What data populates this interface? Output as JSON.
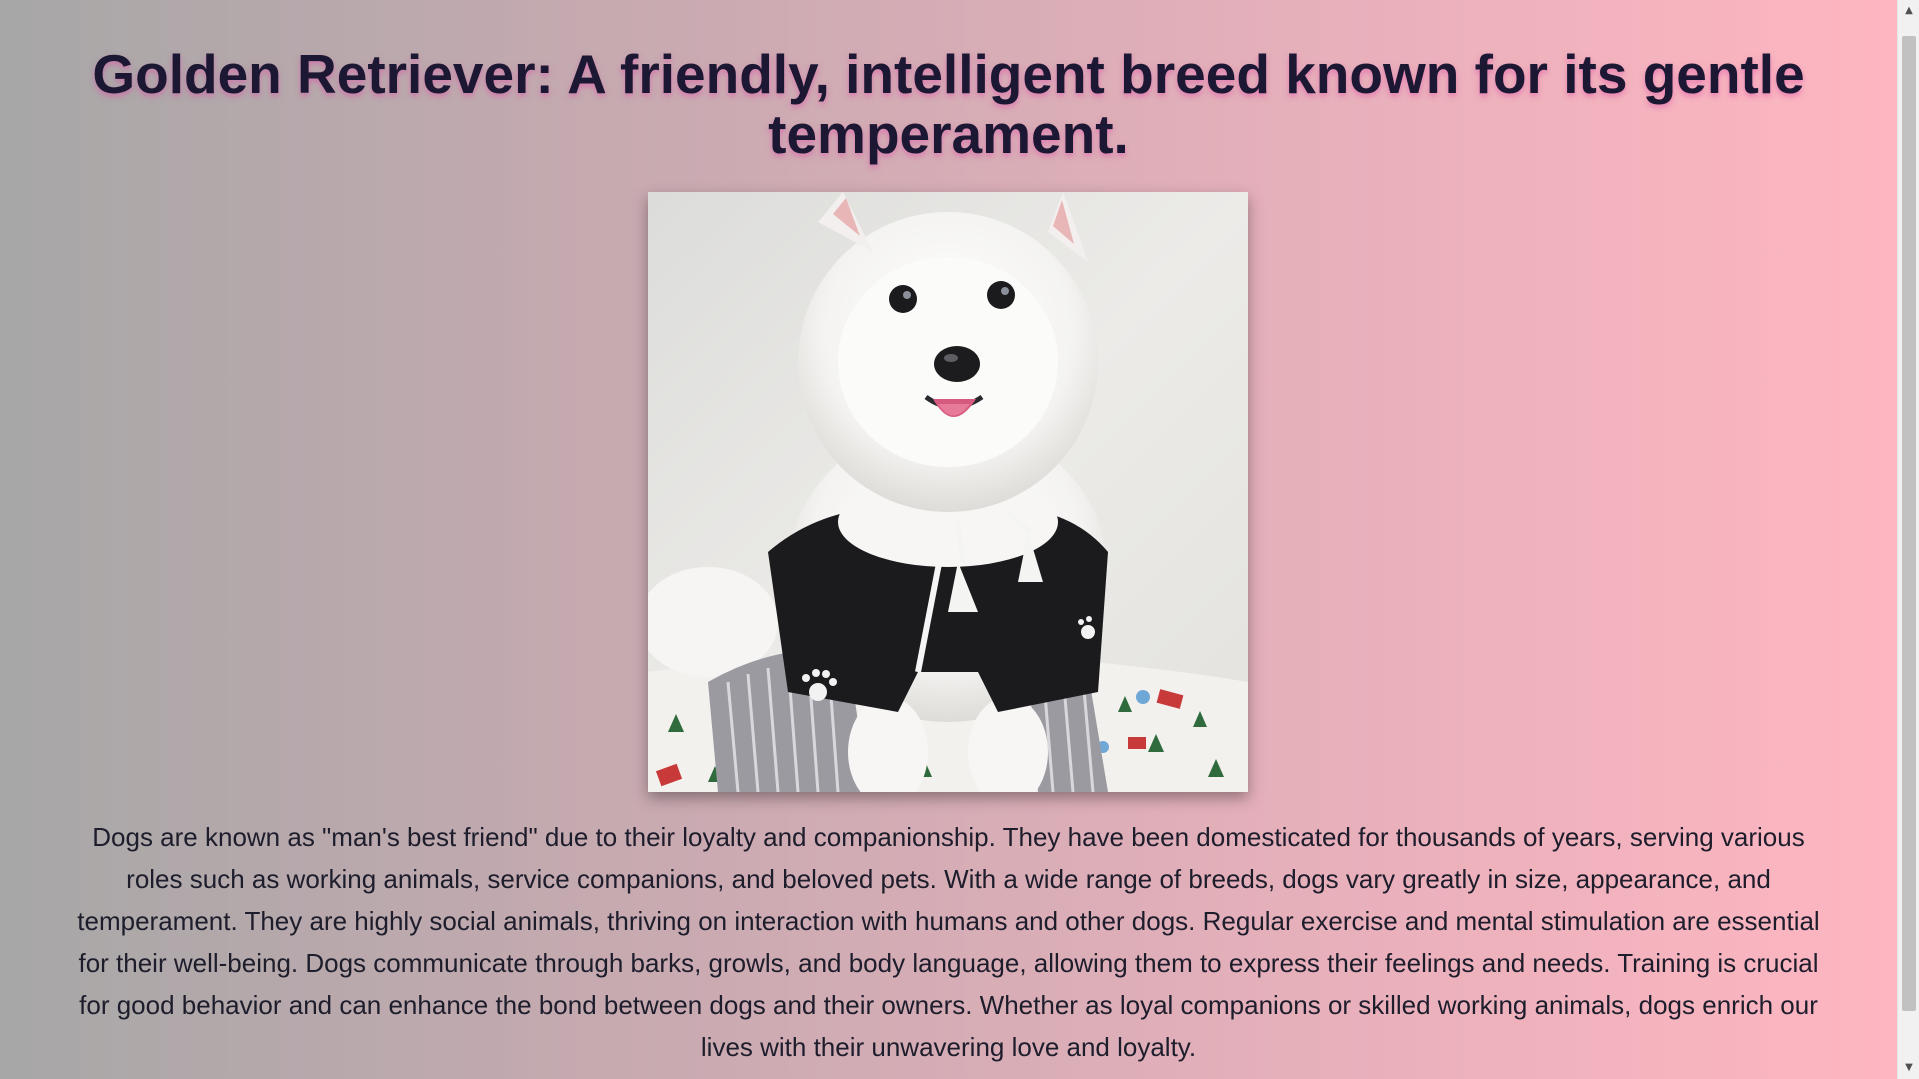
{
  "page": {
    "title": "Golden Retriever: A friendly, intelligent breed known for its gentle temperament.",
    "description": "Dogs are known as \"man's best friend\" due to their loyalty and companionship. They have been domesticated for thousands of years, serving various roles such as working animals, service companions, and beloved pets. With a wide range of breeds, dogs vary greatly in size, appearance, and temperament. They are highly social animals, thriving on interaction with humans and other dogs. Regular exercise and mental stimulation are essential for their well-being. Dogs communicate through barks, growls, and body language, allowing them to express their feelings and needs. Training is crucial for good behavior and can enhance the bond between dogs and their owners. Whether as loyal companions or skilled working animals, dogs enrich our lives with their unwavering love and loyalty.",
    "background_gradient": [
      "#a7a7a7",
      "#feb6c1"
    ],
    "title_color": "#1c1833",
    "title_glow_color": "#e050aa"
  },
  "scrollbar": {
    "up_icon": "triangle-up-icon",
    "down_icon": "triangle-down-icon"
  }
}
